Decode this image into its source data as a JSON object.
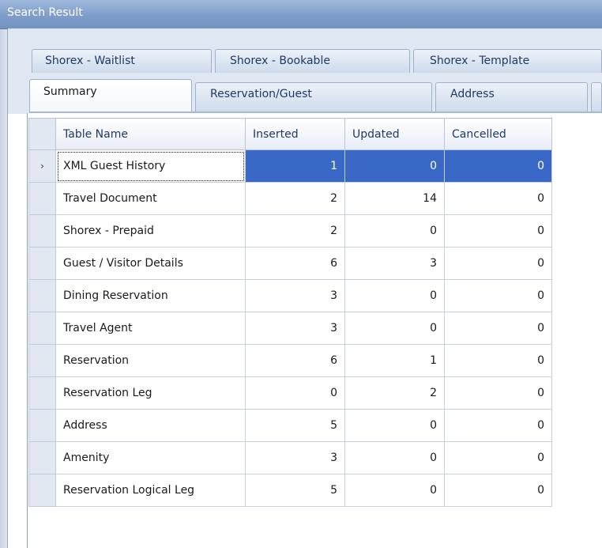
{
  "window": {
    "title": "Search Result"
  },
  "tabs": {
    "row_top": [
      "Shorex - Waitlist",
      "Shorex - Bookable",
      "Shorex - Template"
    ],
    "row_bottom": [
      "Summary",
      "Reservation/Guest",
      "Address"
    ],
    "active": "Summary"
  },
  "grid": {
    "columns": [
      "Table Name",
      "Inserted",
      "Updated",
      "Cancelled"
    ],
    "current_row_marker": "›",
    "rows": [
      {
        "name": "XML Guest History",
        "inserted": "1",
        "updated": "0",
        "cancelled": "0"
      },
      {
        "name": "Travel Document",
        "inserted": "2",
        "updated": "14",
        "cancelled": "0"
      },
      {
        "name": "Shorex - Prepaid",
        "inserted": "2",
        "updated": "0",
        "cancelled": "0"
      },
      {
        "name": "Guest / Visitor Details",
        "inserted": "6",
        "updated": "3",
        "cancelled": "0"
      },
      {
        "name": "Dining Reservation",
        "inserted": "3",
        "updated": "0",
        "cancelled": "0"
      },
      {
        "name": "Travel Agent",
        "inserted": "3",
        "updated": "0",
        "cancelled": "0"
      },
      {
        "name": "Reservation",
        "inserted": "6",
        "updated": "1",
        "cancelled": "0"
      },
      {
        "name": "Reservation Leg",
        "inserted": "0",
        "updated": "2",
        "cancelled": "0"
      },
      {
        "name": "Address",
        "inserted": "5",
        "updated": "0",
        "cancelled": "0"
      },
      {
        "name": "Amenity",
        "inserted": "3",
        "updated": "0",
        "cancelled": "0"
      },
      {
        "name": "Reservation Logical Leg",
        "inserted": "5",
        "updated": "0",
        "cancelled": "0"
      }
    ]
  },
  "colors": {
    "title_bar": "#7e9dc9",
    "selection": "#3a68c7"
  }
}
